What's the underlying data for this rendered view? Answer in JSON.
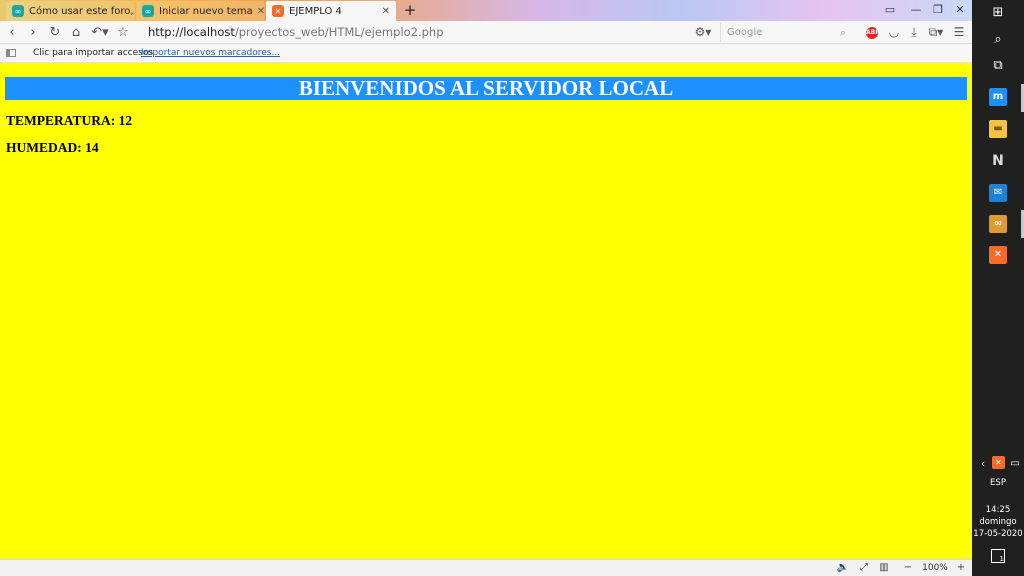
{
  "browser": {
    "tabs": [
      {
        "label": "Cómo usar este foro, po",
        "favicon": "arduino-icon",
        "active": false
      },
      {
        "label": "Iniciar nuevo tema",
        "favicon": "arduino-icon",
        "active": false
      },
      {
        "label": "EJEMPLO 4",
        "favicon": "xampp-icon",
        "active": true
      }
    ],
    "new_tab_label": "+",
    "url_host": "http://localhost",
    "url_path": "/proyectos_web/HTML/ejemplo2.php",
    "search_placeholder": "Google",
    "adblock_label": "ABP",
    "bookmarks": {
      "import_label": "Clic para importar accesos",
      "import_link": "Importar nuevos marcadores..."
    },
    "zoom": "100%",
    "zoom_minus": "−",
    "zoom_plus": "+"
  },
  "page": {
    "heading": "BIENVENIDOS AL SERVIDOR LOCAL",
    "temperature_label": "TEMPERATURA: 12",
    "humidity_label": "HUMEDAD: 14",
    "background_color": "#ffff00",
    "heading_color": "#1e90ff"
  },
  "taskbar": {
    "language": "ESP",
    "time": "14:25",
    "day": "domingo",
    "date": "17-05-2020",
    "notification_count": "1"
  }
}
